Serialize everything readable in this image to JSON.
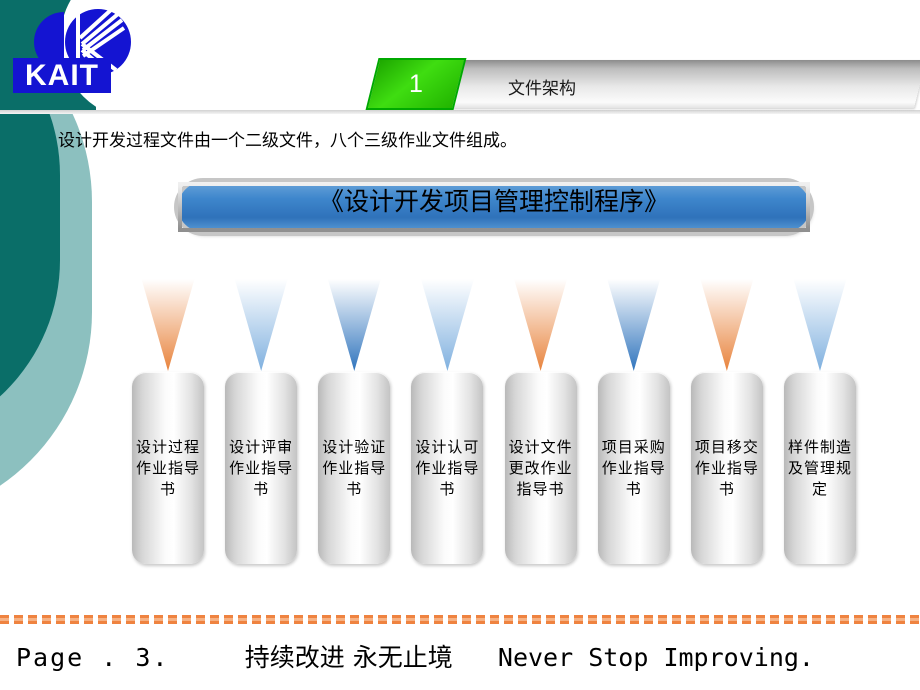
{
  "slide": {
    "logo": {
      "wordmark": "KAIT",
      "icon": "kait-k-logo"
    },
    "header": {
      "number": "1",
      "title": "文件架构"
    },
    "intro": "设计开发过程文件由一个二级文件，八个三级作业文件组成。",
    "main_title": "《设计开发项目管理控制程序》",
    "documents": [
      {
        "label": "设计过程作业指导书",
        "arrow_color": "#e8833c"
      },
      {
        "label": "设计评审作业指导书",
        "arrow_color": "#7fb0df"
      },
      {
        "label": "设计验证作业指导书",
        "arrow_color": "#2f74bd"
      },
      {
        "label": "设计认可作业指导书",
        "arrow_color": "#7fb0df"
      },
      {
        "label": "设计文件更改作业指导书",
        "arrow_color": "#e8833c"
      },
      {
        "label": "项目采购作业指导书",
        "arrow_color": "#2f74bd"
      },
      {
        "label": "项目移交作业指导书",
        "arrow_color": "#e8833c"
      },
      {
        "label": "样件制造及管理规定",
        "arrow_color": "#7fb0df"
      }
    ],
    "footer": {
      "page_label": "Page . 3.",
      "slogan_cn": "持续改进  永无止境",
      "slogan_en": "Never  Stop  Improving."
    },
    "colors": {
      "teal_dark": "#0a6e68",
      "teal_light": "#8cc0bf",
      "green_badge": "#2fc40a",
      "blue_capsule": "#3176bd",
      "orange_accent": "#ef8340",
      "logo_blue": "#1414d2"
    }
  }
}
